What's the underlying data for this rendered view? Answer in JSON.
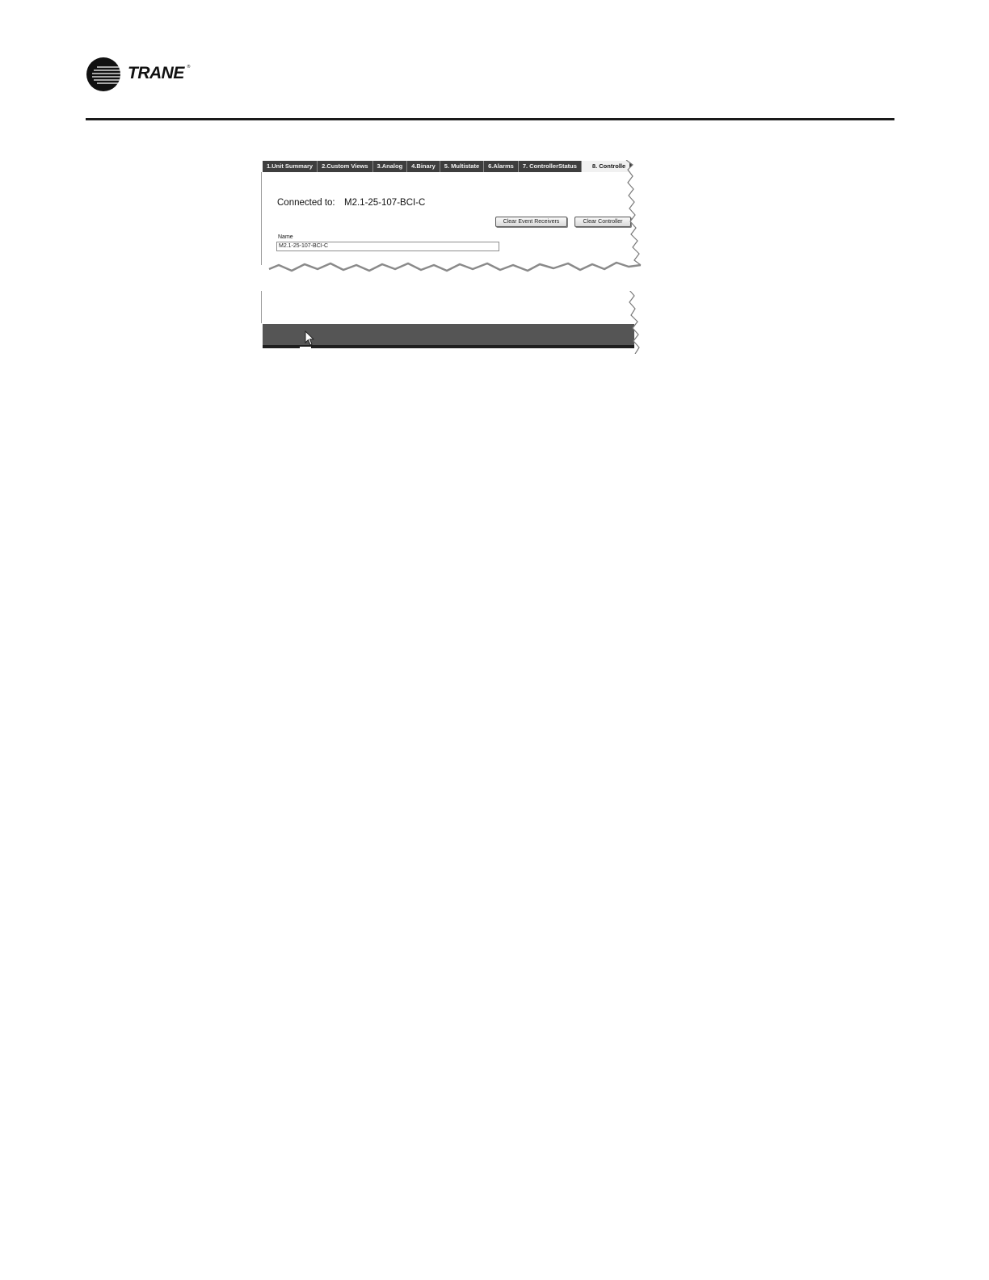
{
  "brand": {
    "name": "TRANE",
    "registered_mark": "®"
  },
  "screenshot": {
    "tabs": [
      {
        "label": "1.Unit Summary"
      },
      {
        "label": "2.Custom Views"
      },
      {
        "label": "3.Analog"
      },
      {
        "label": "4.Binary"
      },
      {
        "label": "5. Multistate"
      },
      {
        "label": "6.Alarms"
      },
      {
        "label": "7. ControllerStatus"
      },
      {
        "label": "8. Controlle",
        "active": true
      }
    ],
    "connected_to_label": "Connected to:",
    "connected_to_value": "M2.1-25-107-BCI-C",
    "buttons": {
      "clear_event_receivers": "Clear Event Receivers",
      "clear_controller": "Clear Controller"
    },
    "name_field": {
      "label": "Name",
      "value": "M2.1-25-107-BCI-C"
    }
  },
  "colors": {
    "tab_bar": "#3e3e3e",
    "active_tab": "#f1f1f1",
    "status_bar": "#555555",
    "header_rule": "#1a1a1a"
  }
}
